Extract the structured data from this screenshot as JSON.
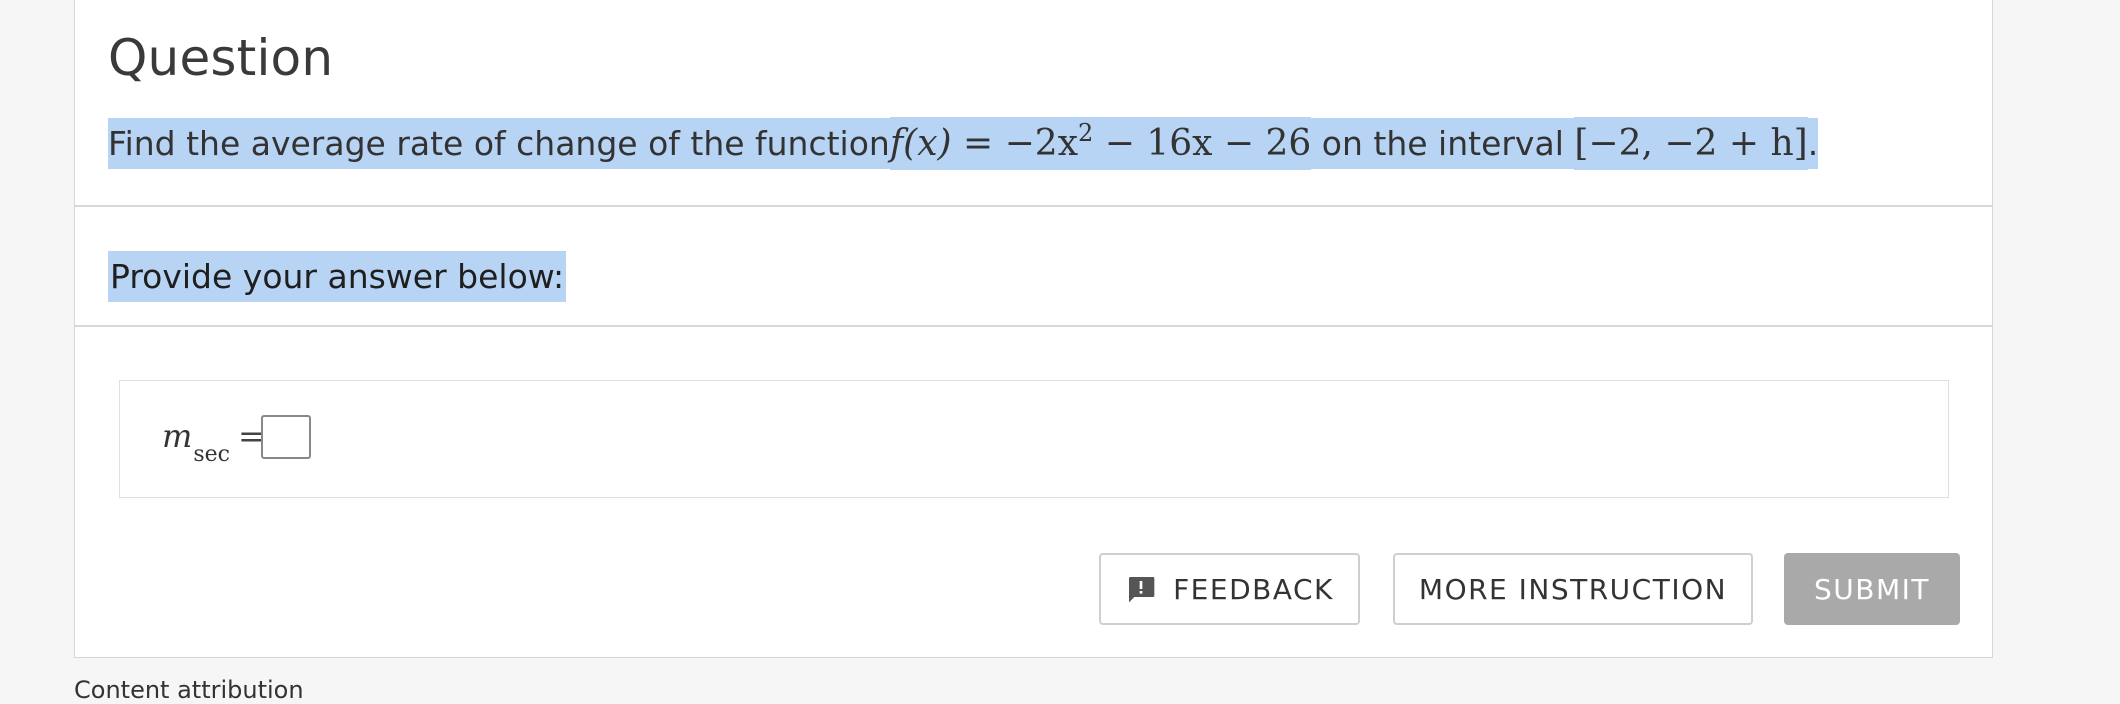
{
  "question": {
    "heading": "Question",
    "text_prefix": "Find the average rate of change of the function",
    "function_lhs": "f(x) = ",
    "function_rhs_part1": "−2x",
    "function_exp": "2",
    "function_rhs_part2": " − 16x − 26",
    "text_middle": " on the interval ",
    "interval": "[−2, −2 + h]",
    "text_suffix": "."
  },
  "prompt": {
    "text": "Provide your answer below:"
  },
  "answer": {
    "label_var": "m",
    "label_sub": "sec",
    "label_eq": "=",
    "input_value": ""
  },
  "buttons": {
    "feedback": "FEEDBACK",
    "more_instruction": "MORE INSTRUCTION",
    "submit": "SUBMIT"
  },
  "footer": {
    "attribution": "Content attribution"
  },
  "colors": {
    "highlight": "#b8d4f5",
    "submit_disabled": "#a9a9a9"
  }
}
